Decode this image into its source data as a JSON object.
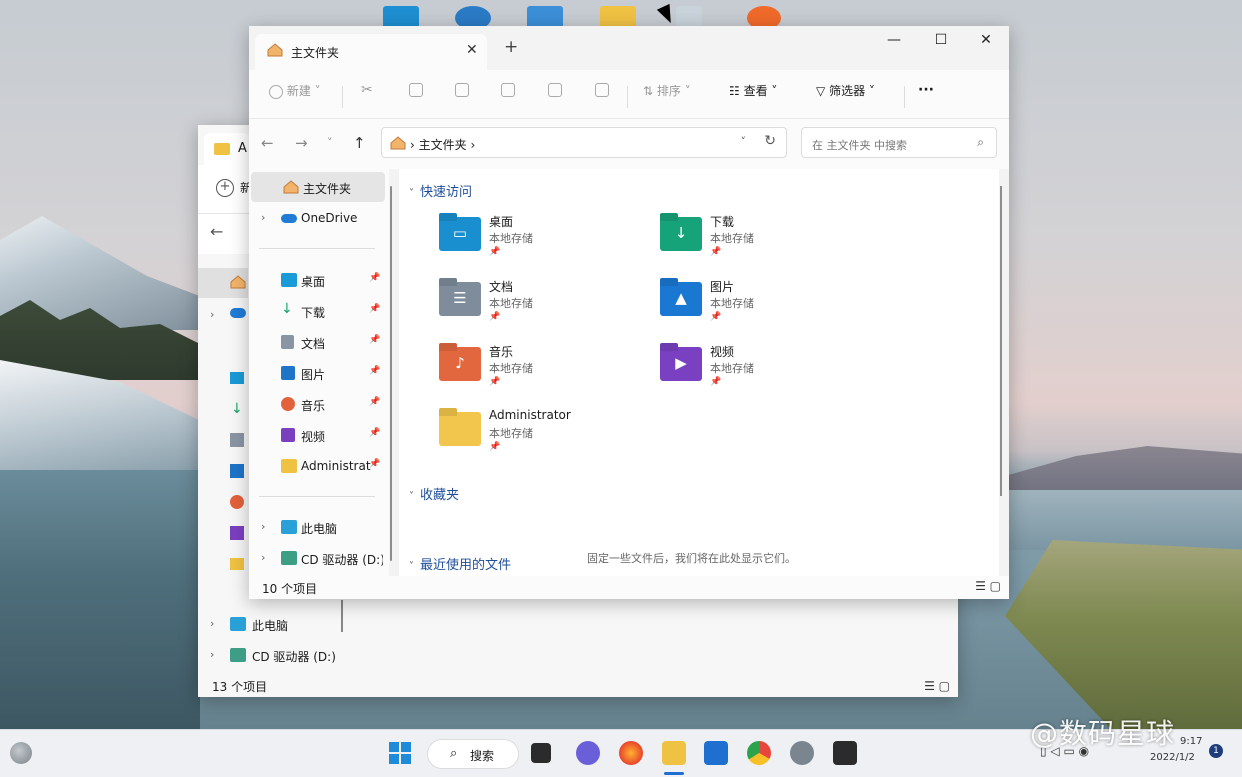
{
  "desktop": {
    "watermark": "@数码星球",
    "tray_date": "2022/1/2",
    "tray_partial": "9:17",
    "badge": "1"
  },
  "back_window": {
    "tab_title": "A",
    "new_label": "新",
    "nav": [
      {
        "label": "此电脑"
      },
      {
        "label": "CD 驱动器 (D:)"
      }
    ],
    "status": "13 个项目"
  },
  "front_window": {
    "tab_title": "主文件夹",
    "tab_close": "✕",
    "new_tab": "+",
    "win_controls": {
      "minimize": "—",
      "maximize": "☐",
      "close": "✕"
    },
    "toolbar": {
      "new": "新建",
      "sort": "排序",
      "view": "查看",
      "filter": "筛选器",
      "more": "···"
    },
    "address": {
      "crumb": "主文件夹",
      "search_placeholder": "在 主文件夹 中搜索"
    },
    "nav": {
      "home": "主文件夹",
      "onedrive": "OneDrive",
      "pinned": [
        {
          "label": "桌面",
          "icon": "desktop-icon",
          "color": "#1a9ad6"
        },
        {
          "label": "下载",
          "icon": "download-icon",
          "color": "#1aa36b"
        },
        {
          "label": "文档",
          "icon": "document-icon",
          "color": "#8a95a3"
        },
        {
          "label": "图片",
          "icon": "picture-icon",
          "color": "#1e74c7"
        },
        {
          "label": "音乐",
          "icon": "music-icon",
          "color": "#e2623c"
        },
        {
          "label": "视频",
          "icon": "video-icon",
          "color": "#7a3fbf"
        },
        {
          "label": "Administrat",
          "icon": "folder-icon",
          "color": "#f0c243"
        }
      ],
      "this_pc": "此电脑",
      "cd_drive": "CD 驱动器 (D:)"
    },
    "sections": {
      "quick_access": "快速访问",
      "favorites": "收藏夹",
      "recent": "最近使用的文件",
      "favorites_hint": "固定一些文件后，我们将在此处显示它们。"
    },
    "folders": [
      {
        "name": "桌面",
        "sub": "本地存储",
        "color": "#1a8fd0",
        "glyph": "▭"
      },
      {
        "name": "下载",
        "sub": "本地存储",
        "color": "#17a37a",
        "glyph": "↓"
      },
      {
        "name": "文档",
        "sub": "本地存储",
        "color": "#7e8c9c",
        "glyph": "☰"
      },
      {
        "name": "图片",
        "sub": "本地存储",
        "color": "#1b78d2",
        "glyph": "▲"
      },
      {
        "name": "音乐",
        "sub": "本地存储",
        "color": "#e2673f",
        "glyph": "♪"
      },
      {
        "name": "视频",
        "sub": "本地存储",
        "color": "#7a40c2",
        "glyph": "▶"
      },
      {
        "name": "Administrator",
        "sub": "本地存储",
        "color": "#f2c64c",
        "glyph": ""
      }
    ],
    "status": "10 个项目"
  },
  "taskbar": {
    "search_label": "搜索"
  }
}
